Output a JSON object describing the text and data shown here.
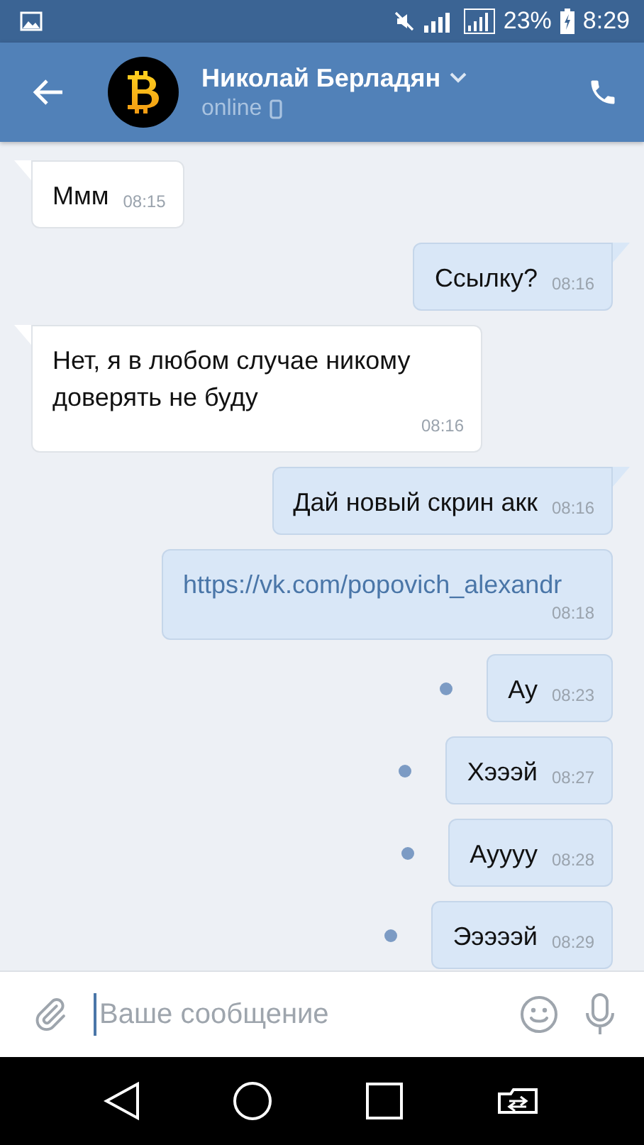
{
  "status_bar": {
    "battery": "23%",
    "time": "8:29"
  },
  "header": {
    "name": "Николай Берладян",
    "status": "online"
  },
  "messages": [
    {
      "outgoing": false,
      "kind": "text",
      "text": "Ммм",
      "time": "08:15",
      "tail": true,
      "unread": false
    },
    {
      "outgoing": true,
      "kind": "text",
      "text": "Ссылку?",
      "time": "08:16",
      "tail": true,
      "unread": false
    },
    {
      "outgoing": false,
      "kind": "text",
      "text": "Нет, я в любом случае никому доверять не буду",
      "time": "08:16",
      "tail": true,
      "unread": false
    },
    {
      "outgoing": true,
      "kind": "text",
      "text": "Дай новый скрин акк",
      "time": "08:16",
      "tail": true,
      "unread": false
    },
    {
      "outgoing": true,
      "kind": "link",
      "text": "https://vk.com/popovich_alexandr",
      "time": "08:18",
      "tail": false,
      "unread": false
    },
    {
      "outgoing": true,
      "kind": "text",
      "text": "Ау",
      "time": "08:23",
      "tail": false,
      "unread": true
    },
    {
      "outgoing": true,
      "kind": "text",
      "text": "Хэээй",
      "time": "08:27",
      "tail": false,
      "unread": true
    },
    {
      "outgoing": true,
      "kind": "text",
      "text": "Ауууу",
      "time": "08:28",
      "tail": false,
      "unread": true
    },
    {
      "outgoing": true,
      "kind": "text",
      "text": "Эээээй",
      "time": "08:29",
      "tail": false,
      "unread": true
    }
  ],
  "composer": {
    "placeholder": "Ваше сообщение"
  }
}
